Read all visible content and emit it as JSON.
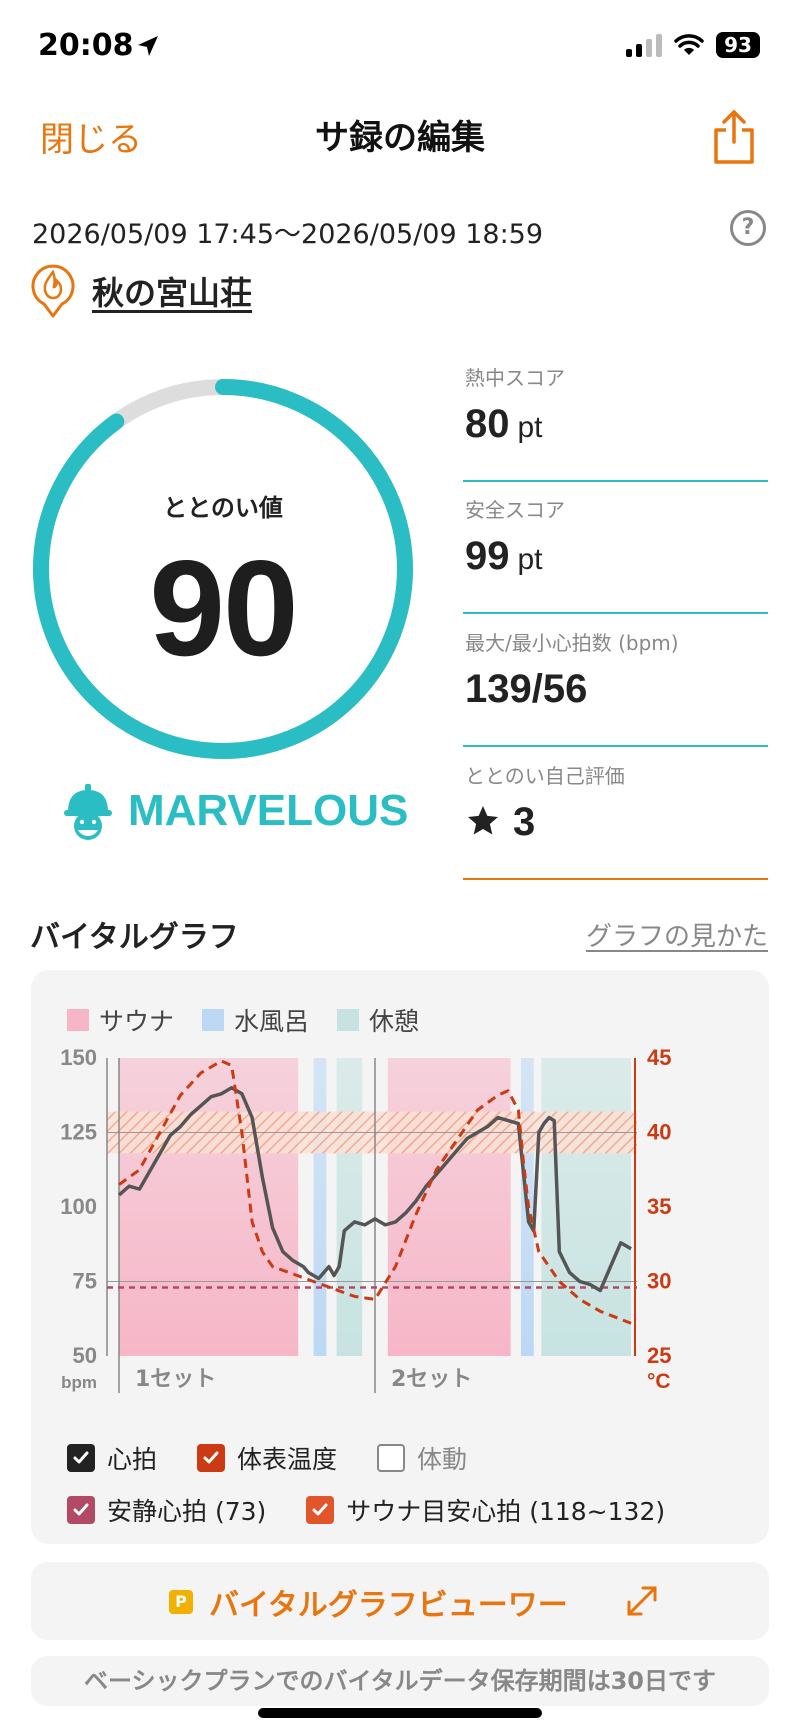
{
  "status": {
    "time": "20:08",
    "battery": "93"
  },
  "nav": {
    "close_label": "閉じる",
    "title": "サ録の編集"
  },
  "session": {
    "date_range": "2026/05/09 17:45～2026/05/09 18:59",
    "facility": "秋の宮山荘"
  },
  "score": {
    "label": "ととのい値",
    "value": "90",
    "progress": 0.9,
    "rank": "MARVELOUS"
  },
  "metrics": [
    {
      "label": "熱中スコア",
      "value": "80",
      "unit": "pt"
    },
    {
      "label": "安全スコア",
      "value": "99",
      "unit": "pt"
    },
    {
      "label": "最大/最小心拍数 (bpm)",
      "value": "139/56",
      "unit": ""
    },
    {
      "label": "ととのい自己評価",
      "value": "3",
      "unit": ""
    }
  ],
  "graph_section": {
    "title": "バイタルグラフ",
    "howto_link": "グラフの見かた"
  },
  "legend": [
    {
      "label": "サウナ",
      "color": "#f6b6c8"
    },
    {
      "label": "水風呂",
      "color": "#bcd8f4"
    },
    {
      "label": "休憩",
      "color": "#c7e3e1"
    }
  ],
  "checks": [
    {
      "label": "心拍",
      "checked": true,
      "color": "#222222"
    },
    {
      "label": "体表温度",
      "checked": true,
      "color": "#cc3a14"
    },
    {
      "label": "体動",
      "checked": false,
      "color": "#888888"
    },
    {
      "label": "安静心拍 (73)",
      "checked": true,
      "color": "#b24a66"
    },
    {
      "label": "サウナ目安心拍 (118~132)",
      "checked": true,
      "color": "#e2552a"
    }
  ],
  "chart_data": {
    "type": "line",
    "y_left": {
      "label": "bpm",
      "ticks": [
        150,
        125,
        100,
        75,
        50
      ],
      "range": [
        50,
        150
      ]
    },
    "y_right": {
      "label": "°C",
      "ticks": [
        45,
        40,
        35,
        30,
        25
      ],
      "range": [
        25,
        45
      ]
    },
    "x_range": [
      0,
      100
    ],
    "set_labels": [
      "1セット",
      "2セット"
    ],
    "set_starts": [
      0,
      50
    ],
    "phases": [
      {
        "type": "sauna",
        "start": 0,
        "end": 35
      },
      {
        "type": "cold",
        "start": 38,
        "end": 40.5
      },
      {
        "type": "rest",
        "start": 42.5,
        "end": 47.5
      },
      {
        "type": "sauna",
        "start": 52.5,
        "end": 76.5
      },
      {
        "type": "cold",
        "start": 78.5,
        "end": 81
      },
      {
        "type": "rest",
        "start": 82.5,
        "end": 100
      }
    ],
    "resting_hr": 73,
    "target_hr_band": [
      118,
      132
    ],
    "heart_rate": {
      "name": "心拍",
      "x": [
        0,
        2,
        4,
        6,
        8,
        10,
        12,
        14,
        16,
        18,
        20,
        22,
        24,
        26,
        28,
        30,
        32,
        34,
        36,
        37,
        38,
        39,
        40,
        41,
        42,
        43,
        44,
        46,
        48,
        50,
        52,
        54,
        56,
        58,
        60,
        62,
        64,
        66,
        68,
        70,
        72,
        74,
        76,
        78,
        80,
        81,
        82,
        83,
        84,
        85,
        86,
        88,
        90,
        92,
        94,
        96,
        98,
        100
      ],
      "y": [
        104,
        107,
        106,
        112,
        118,
        124,
        127,
        131,
        134,
        137,
        138,
        140,
        138,
        130,
        110,
        93,
        85,
        82,
        80,
        78,
        77,
        76,
        78,
        80,
        77,
        80,
        92,
        95,
        94,
        96,
        94,
        95,
        98,
        102,
        107,
        111,
        115,
        119,
        123,
        125,
        127,
        130,
        129,
        128,
        95,
        92,
        125,
        128,
        130,
        129,
        85,
        78,
        75,
        74,
        72,
        80,
        88,
        86
      ]
    },
    "skin_temp": {
      "name": "体表温度",
      "x": [
        0,
        4,
        8,
        12,
        16,
        20,
        22,
        24,
        25,
        26,
        28,
        30,
        34,
        38,
        42,
        46,
        50,
        54,
        58,
        62,
        66,
        70,
        74,
        76,
        78,
        79,
        80,
        82,
        86,
        90,
        94,
        100
      ],
      "y": [
        36.5,
        37.5,
        40,
        42.5,
        44,
        44.8,
        44.5,
        40,
        37,
        34,
        32,
        31,
        30.5,
        30,
        29.5,
        29,
        28.8,
        31,
        34.5,
        37.5,
        39.5,
        41.5,
        42.5,
        42.8,
        41.5,
        38,
        35,
        32,
        30,
        28.8,
        28,
        27.2
      ]
    }
  }
}
